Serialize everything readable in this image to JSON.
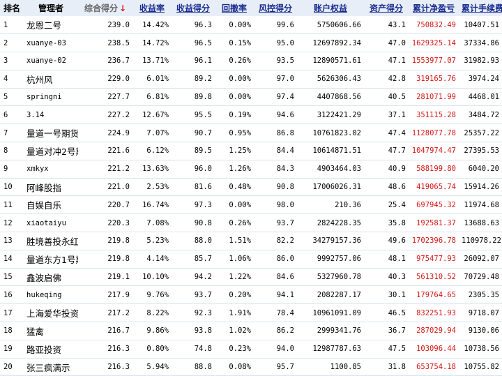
{
  "headers": [
    {
      "label": "排名",
      "style": "plain"
    },
    {
      "label": "管理者",
      "style": "plain"
    },
    {
      "label": "综合得分",
      "style": "sorted"
    },
    {
      "label": "收益率",
      "style": "link"
    },
    {
      "label": "收益得分",
      "style": "link"
    },
    {
      "label": "回撤率",
      "style": "link"
    },
    {
      "label": "风控得分",
      "style": "link"
    },
    {
      "label": "账户权益",
      "style": "link"
    },
    {
      "label": "资产得分",
      "style": "link"
    },
    {
      "label": "累计净盈亏",
      "style": "link"
    },
    {
      "label": "累计手续费",
      "style": "link"
    }
  ],
  "sort_indicator": "↓",
  "colors": {
    "header_bg": "#e8eef7",
    "link": "#1a2d8f",
    "profit": "#d41414",
    "row_border": "#d9e3ef"
  },
  "rows": [
    {
      "rank": "1",
      "name": "龙恩二号",
      "score": "239.0",
      "return_rate": "14.42%",
      "return_score": "96.3",
      "drawdown": "0.00%",
      "risk_score": "99.6",
      "equity": "5750606.66",
      "asset_score": "43.1",
      "net_pnl": "750832.49",
      "fees": "10407.51"
    },
    {
      "rank": "2",
      "name": "xuanye-03",
      "score": "238.5",
      "return_rate": "14.72%",
      "return_score": "96.5",
      "drawdown": "0.15%",
      "risk_score": "95.0",
      "equity": "12697892.34",
      "asset_score": "47.0",
      "net_pnl": "1629325.14",
      "fees": "37334.86"
    },
    {
      "rank": "3",
      "name": "xuanye-02",
      "score": "236.7",
      "return_rate": "13.71%",
      "return_score": "96.1",
      "drawdown": "0.26%",
      "risk_score": "93.5",
      "equity": "12890571.61",
      "asset_score": "47.1",
      "net_pnl": "1553977.07",
      "fees": "31982.93"
    },
    {
      "rank": "4",
      "name": "杭州风",
      "score": "229.0",
      "return_rate": "6.01%",
      "return_score": "89.2",
      "drawdown": "0.00%",
      "risk_score": "97.0",
      "equity": "5626306.43",
      "asset_score": "42.8",
      "net_pnl": "319165.76",
      "fees": "3974.24"
    },
    {
      "rank": "5",
      "name": "springni",
      "score": "227.7",
      "return_rate": "6.81%",
      "return_score": "89.8",
      "drawdown": "0.00%",
      "risk_score": "97.4",
      "equity": "4407868.56",
      "asset_score": "40.5",
      "net_pnl": "281071.99",
      "fees": "4468.01"
    },
    {
      "rank": "6",
      "name": "3.14",
      "score": "227.2",
      "return_rate": "12.67%",
      "return_score": "95.5",
      "drawdown": "0.19%",
      "risk_score": "94.6",
      "equity": "3122421.29",
      "asset_score": "37.1",
      "net_pnl": "351115.28",
      "fees": "3484.72"
    },
    {
      "rank": "7",
      "name": "量道一号期货",
      "score": "224.9",
      "return_rate": "7.07%",
      "return_score": "90.7",
      "drawdown": "0.95%",
      "risk_score": "86.8",
      "equity": "10761823.02",
      "asset_score": "47.4",
      "net_pnl": "1128077.78",
      "fees": "25357.22"
    },
    {
      "rank": "8",
      "name": "量道对冲2号期",
      "score": "221.6",
      "return_rate": "6.12%",
      "return_score": "89.5",
      "drawdown": "1.25%",
      "risk_score": "84.4",
      "equity": "10614871.51",
      "asset_score": "47.7",
      "net_pnl": "1047974.47",
      "fees": "27395.53"
    },
    {
      "rank": "9",
      "name": "xmkyx",
      "score": "221.2",
      "return_rate": "13.63%",
      "return_score": "96.0",
      "drawdown": "1.26%",
      "risk_score": "84.3",
      "equity": "4903464.03",
      "asset_score": "40.9",
      "net_pnl": "588199.80",
      "fees": "6040.20"
    },
    {
      "rank": "10",
      "name": "阿峰股指",
      "score": "221.0",
      "return_rate": "2.53%",
      "return_score": "81.6",
      "drawdown": "0.48%",
      "risk_score": "90.8",
      "equity": "17006026.31",
      "asset_score": "48.6",
      "net_pnl": "419065.74",
      "fees": "15914.26"
    },
    {
      "rank": "11",
      "name": "自娱自乐",
      "score": "220.7",
      "return_rate": "16.74%",
      "return_score": "97.3",
      "drawdown": "0.00%",
      "risk_score": "98.0",
      "equity": "210.36",
      "asset_score": "25.4",
      "net_pnl": "697945.32",
      "fees": "11974.68"
    },
    {
      "rank": "12",
      "name": "xiaotaiyu",
      "score": "220.3",
      "return_rate": "7.08%",
      "return_score": "90.8",
      "drawdown": "0.26%",
      "risk_score": "93.7",
      "equity": "2824228.35",
      "asset_score": "35.8",
      "net_pnl": "192581.37",
      "fees": "13688.63"
    },
    {
      "rank": "13",
      "name": "胜境善投永红",
      "score": "219.8",
      "return_rate": "5.23%",
      "return_score": "88.0",
      "drawdown": "1.51%",
      "risk_score": "82.2",
      "equity": "34279157.36",
      "asset_score": "49.6",
      "net_pnl": "1702396.78",
      "fees": "110978.22"
    },
    {
      "rank": "14",
      "name": "量道东方1号期",
      "score": "219.8",
      "return_rate": "4.14%",
      "return_score": "85.7",
      "drawdown": "1.06%",
      "risk_score": "86.0",
      "equity": "9992757.06",
      "asset_score": "48.1",
      "net_pnl": "975477.93",
      "fees": "26092.07"
    },
    {
      "rank": "15",
      "name": "鑫波启佛",
      "score": "219.1",
      "return_rate": "10.10%",
      "return_score": "94.2",
      "drawdown": "1.22%",
      "risk_score": "84.6",
      "equity": "5327960.78",
      "asset_score": "40.3",
      "net_pnl": "561310.52",
      "fees": "70729.48"
    },
    {
      "rank": "16",
      "name": "hukeqing",
      "score": "217.9",
      "return_rate": "9.76%",
      "return_score": "93.7",
      "drawdown": "0.20%",
      "risk_score": "94.1",
      "equity": "2082287.17",
      "asset_score": "30.1",
      "net_pnl": "179764.65",
      "fees": "2305.35"
    },
    {
      "rank": "17",
      "name": "上海爱华投资",
      "score": "217.2",
      "return_rate": "8.22%",
      "return_score": "92.3",
      "drawdown": "1.91%",
      "risk_score": "78.4",
      "equity": "10961091.09",
      "asset_score": "46.5",
      "net_pnl": "832251.93",
      "fees": "9718.07"
    },
    {
      "rank": "18",
      "name": "猛禽",
      "score": "216.7",
      "return_rate": "9.86%",
      "return_score": "93.8",
      "drawdown": "1.02%",
      "risk_score": "86.2",
      "equity": "2999341.76",
      "asset_score": "36.7",
      "net_pnl": "287029.94",
      "fees": "9130.06"
    },
    {
      "rank": "19",
      "name": "路亚投资",
      "score": "216.3",
      "return_rate": "0.80%",
      "return_score": "74.8",
      "drawdown": "0.23%",
      "risk_score": "94.0",
      "equity": "12987787.63",
      "asset_score": "47.5",
      "net_pnl": "103096.44",
      "fees": "10738.56"
    },
    {
      "rank": "20",
      "name": "张三疯满示",
      "score": "216.3",
      "return_rate": "5.94%",
      "return_score": "88.8",
      "drawdown": "0.08%",
      "risk_score": "95.7",
      "equity": "1100.85",
      "asset_score": "31.8",
      "net_pnl": "653754.18",
      "fees": "10755.82"
    }
  ]
}
